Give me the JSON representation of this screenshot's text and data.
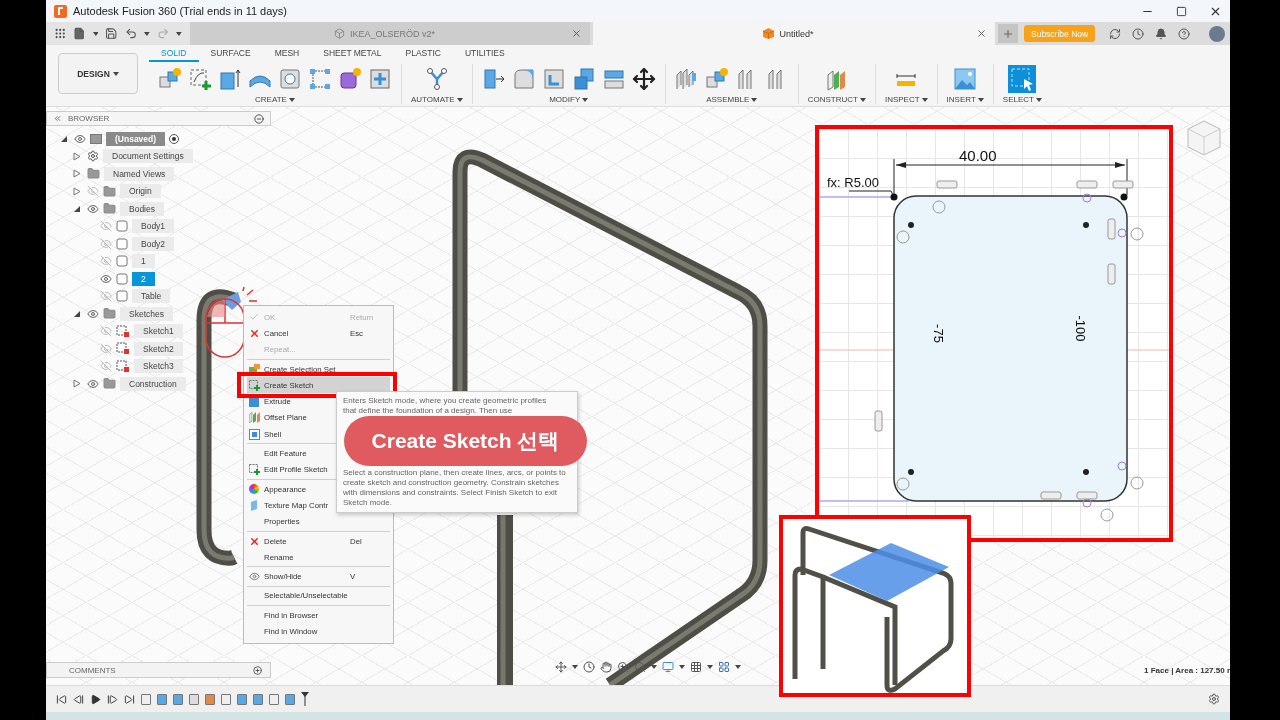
{
  "window": {
    "title": "Autodesk Fusion 360 (Trial ends in 11 days)"
  },
  "document_tabs": [
    {
      "title": "IKEA_OLSERÖD v2*",
      "selected": false
    },
    {
      "title": "Untitled*",
      "selected": true
    }
  ],
  "subscribe_button": "Subscribe Now",
  "workspace_button": "DESIGN",
  "toolbar_tabs": [
    {
      "label": "SOLID",
      "selected": true
    },
    {
      "label": "SURFACE",
      "selected": false
    },
    {
      "label": "MESH",
      "selected": false
    },
    {
      "label": "SHEET METAL",
      "selected": false
    },
    {
      "label": "PLASTIC",
      "selected": false
    },
    {
      "label": "UTILITIES",
      "selected": false
    }
  ],
  "toolbar_groups": [
    {
      "label": "CREATE"
    },
    {
      "label": "AUTOMATE"
    },
    {
      "label": "MODIFY"
    },
    {
      "label": "ASSEMBLE"
    },
    {
      "label": "CONSTRUCT"
    },
    {
      "label": "INSPECT"
    },
    {
      "label": "INSERT"
    },
    {
      "label": "SELECT"
    }
  ],
  "browser": {
    "title": "BROWSER",
    "tree": [
      {
        "label": "(Unsaved)",
        "kind": "component",
        "expanded": true,
        "visible": true,
        "selected": false,
        "children": [
          {
            "label": "Document Settings",
            "kind": "settings",
            "expanded": false,
            "selected": false
          },
          {
            "label": "Named Views",
            "kind": "folder",
            "expanded": false,
            "selected": false
          },
          {
            "label": "Origin",
            "kind": "folder",
            "expanded": false,
            "visible": false,
            "selected": false
          },
          {
            "label": "Bodies",
            "kind": "folder",
            "expanded": true,
            "visible": true,
            "selected": false,
            "children": [
              {
                "label": "Body1",
                "kind": "body",
                "visible": false,
                "selected": false
              },
              {
                "label": "Body2",
                "kind": "body",
                "visible": false,
                "selected": false
              },
              {
                "label": "1",
                "kind": "body",
                "visible": false,
                "selected": false
              },
              {
                "label": "2",
                "kind": "body",
                "visible": true,
                "selected": true
              },
              {
                "label": "Table",
                "kind": "body",
                "visible": false,
                "selected": false
              }
            ]
          },
          {
            "label": "Sketches",
            "kind": "folder",
            "expanded": true,
            "visible": true,
            "selected": false,
            "children": [
              {
                "label": "Sketch1",
                "kind": "sketch",
                "visible": false,
                "selected": false
              },
              {
                "label": "Sketch2",
                "kind": "sketch",
                "visible": false,
                "selected": false
              },
              {
                "label": "Sketch3",
                "kind": "sketch",
                "visible": false,
                "selected": false
              }
            ]
          },
          {
            "label": "Construction",
            "kind": "folder",
            "expanded": false,
            "visible": true,
            "selected": false
          }
        ]
      }
    ]
  },
  "context_menu": {
    "groups": [
      [
        {
          "label": "OK",
          "shortcut": "Return",
          "kind": "check",
          "disabled": true,
          "selected": false
        },
        {
          "label": "Cancel",
          "shortcut": "Esc",
          "kind": "cancel",
          "disabled": false,
          "selected": false
        },
        {
          "label": "Repeat...",
          "kind": "plain",
          "disabled": true,
          "selected": false
        }
      ],
      [
        {
          "label": "Create Selection Set",
          "kind": "selection-set",
          "disabled": false,
          "selected": false
        },
        {
          "label": "Create Sketch",
          "kind": "sketch",
          "disabled": false,
          "selected": true
        },
        {
          "label": "Extrude",
          "kind": "extrude",
          "disabled": false,
          "selected": false
        },
        {
          "label": "Offset Plane",
          "kind": "plane",
          "disabled": false,
          "selected": false
        },
        {
          "label": "Shell",
          "kind": "shell",
          "disabled": false,
          "selected": false
        }
      ],
      [
        {
          "label": "Edit Feature",
          "kind": "plain",
          "disabled": false,
          "selected": false
        },
        {
          "label": "Edit Profile Sketch",
          "kind": "sketch",
          "disabled": false,
          "selected": false
        }
      ],
      [
        {
          "label": "Appearance",
          "kind": "appearance",
          "disabled": false,
          "selected": false
        },
        {
          "label": "Texture Map Contr",
          "kind": "texture",
          "disabled": false,
          "selected": false
        },
        {
          "label": "Properties",
          "kind": "plain",
          "disabled": false,
          "selected": false
        }
      ],
      [
        {
          "label": "Delete",
          "shortcut": "Del",
          "kind": "cancel",
          "disabled": false,
          "selected": false
        },
        {
          "label": "Rename",
          "kind": "plain",
          "disabled": false,
          "selected": false
        }
      ],
      [
        {
          "label": "Show/Hide",
          "shortcut": "V",
          "kind": "eye",
          "disabled": false,
          "selected": false
        }
      ],
      [
        {
          "label": "Selectable/Unselectable",
          "kind": "plain",
          "disabled": false,
          "selected": false
        }
      ],
      [
        {
          "label": "Find in Browser",
          "kind": "plain",
          "disabled": false,
          "selected": false
        },
        {
          "label": "Find in Window",
          "kind": "plain",
          "disabled": false,
          "selected": false
        }
      ]
    ]
  },
  "tooltip": {
    "lines": [
      "Enters Sketch mode, where you create geometric profiles",
      "that define the foundation of a design. Then use"
    ],
    "body": "Select a construction plane, then create lines, arcs, or points to create sketch and construction geometry. Constrain sketches with dimensions and constraints. Select Finish Sketch to exit Sketch mode."
  },
  "annotation": "Create Sketch 선택",
  "sketch": {
    "width_dimension": "40.00",
    "fillet": "fx: R5.00",
    "left_dimension": "-75",
    "right_dimension": "-100"
  },
  "comments": "COMMENTS",
  "status": "1 Face | Area : 127.50 r"
}
